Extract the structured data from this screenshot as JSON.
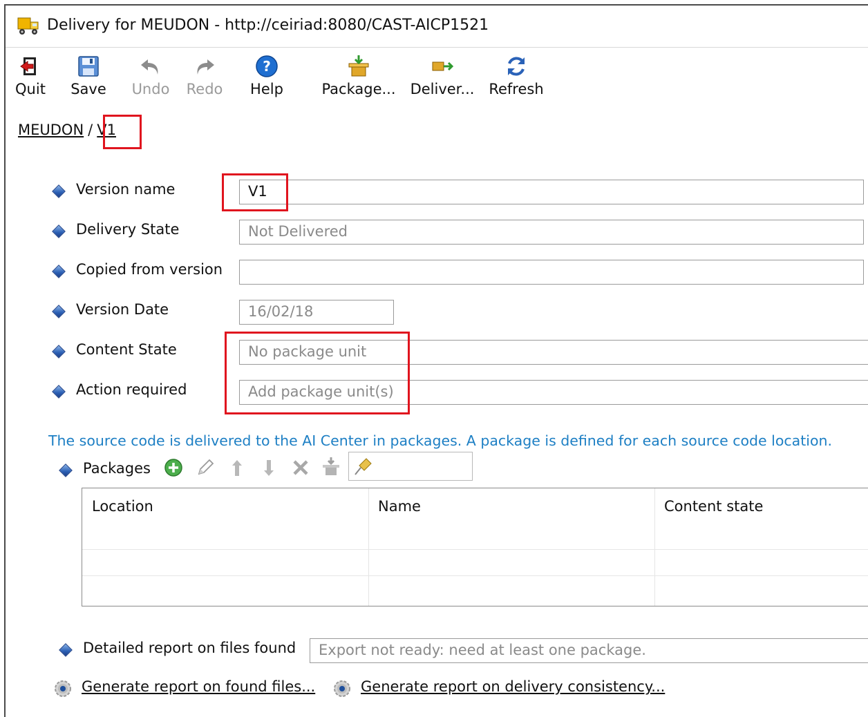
{
  "window": {
    "title": "Delivery for MEUDON - http://ceiriad:8080/CAST-AICP1521",
    "app_icon": "truck-icon"
  },
  "toolbar": {
    "buttons": [
      {
        "label": "Quit",
        "icon": "quit-icon",
        "enabled": true
      },
      {
        "label": "Save",
        "icon": "save-icon",
        "enabled": true
      },
      {
        "label": "Undo",
        "icon": "undo-icon",
        "enabled": false
      },
      {
        "label": "Redo",
        "icon": "redo-icon",
        "enabled": false
      },
      {
        "label": "Help",
        "icon": "help-icon",
        "enabled": true
      },
      {
        "label": "Package...",
        "icon": "package-icon",
        "enabled": true
      },
      {
        "label": "Deliver...",
        "icon": "deliver-icon",
        "enabled": true
      },
      {
        "label": "Refresh",
        "icon": "refresh-icon",
        "enabled": true
      }
    ]
  },
  "breadcrumb": {
    "root": "MEUDON",
    "separator": "/",
    "current": "V1"
  },
  "form": {
    "version_name": {
      "label": "Version name",
      "value": "V1"
    },
    "delivery_state": {
      "label": "Delivery State",
      "value": "Not Delivered"
    },
    "copied_from": {
      "label": "Copied from version",
      "value": ""
    },
    "version_date": {
      "label": "Version Date",
      "value": "16/02/18"
    },
    "content_state": {
      "label": "Content State",
      "value": "No package unit"
    },
    "action_required": {
      "label": "Action required",
      "value": "Add package unit(s)"
    }
  },
  "info_text": "The source code is delivered to the AI Center in packages. A package is defined for each source code location.",
  "packages": {
    "label": "Packages",
    "tools": [
      "add-icon",
      "edit-icon",
      "move-up-icon",
      "move-down-icon",
      "delete-icon",
      "package-import-icon",
      "pin-icon"
    ],
    "filter_value": "",
    "columns": [
      "Location",
      "Name",
      "Content state"
    ],
    "rows": []
  },
  "report": {
    "label": "Detailed report on files found",
    "value": "Export not ready: need at least one package."
  },
  "links": {
    "found_files": "Generate report on found files...",
    "delivery_consistency": "Generate report on delivery consistency..."
  },
  "colors": {
    "highlight": "#e0141e",
    "info_text": "#1d7fc4",
    "placeholder_text": "#8a8a8a"
  }
}
